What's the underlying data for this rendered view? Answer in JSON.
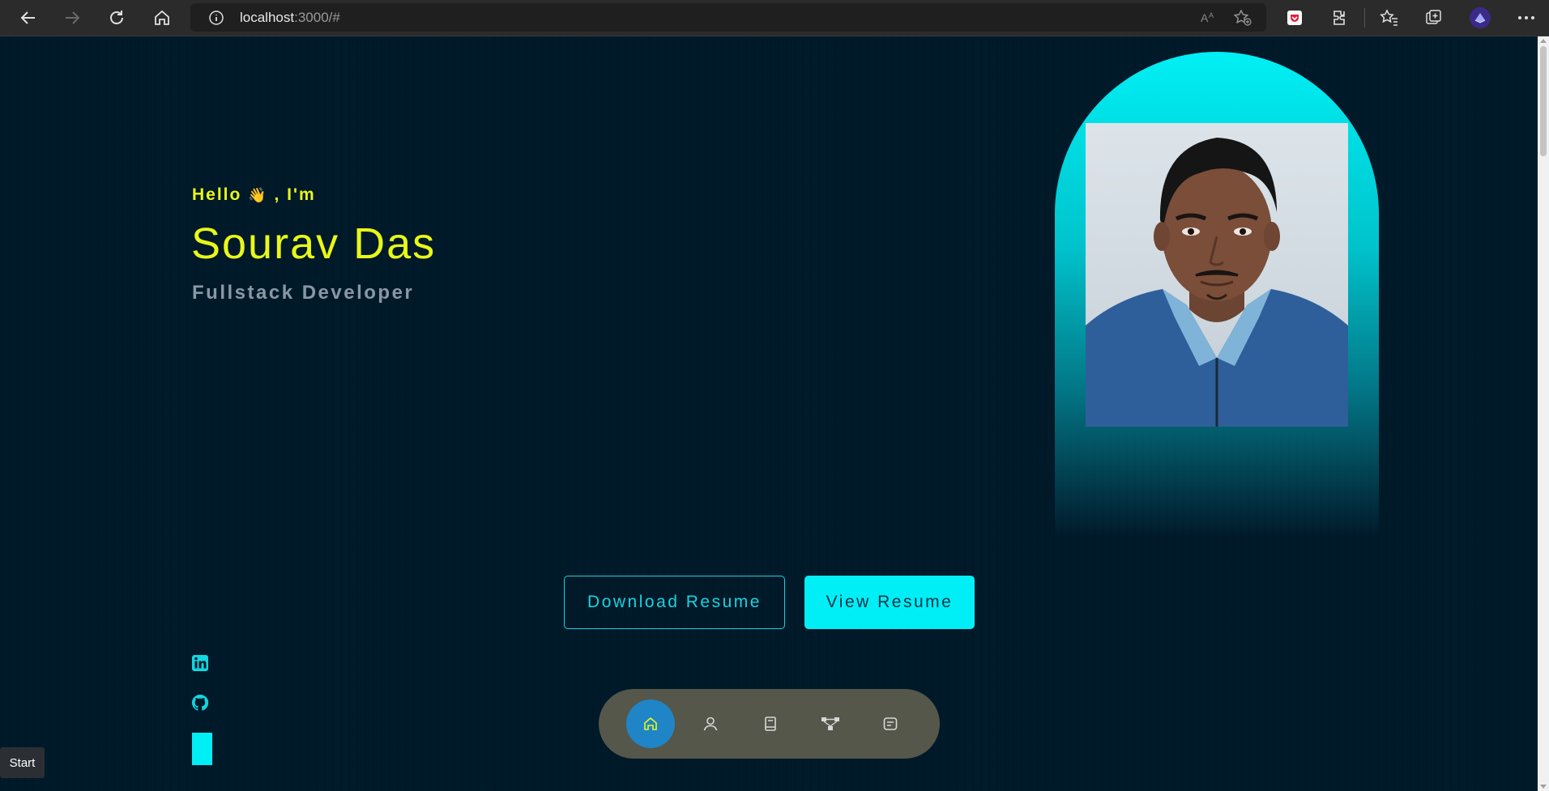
{
  "browser": {
    "url_host": "localhost",
    "url_rest": ":3000/#"
  },
  "hero": {
    "greeting_pre": "Hello",
    "greeting_emoji": "👋",
    "greeting_post": ", I'm",
    "name": "Sourav Das",
    "role": "Fullstack Developer"
  },
  "buttons": {
    "download": "Download Resume",
    "view": "View Resume"
  },
  "nav": {
    "items": [
      "home-icon",
      "user-icon",
      "book-icon",
      "sitemap-icon",
      "message-icon"
    ],
    "active": "home"
  },
  "tooltip": {
    "label": "Start"
  },
  "colors": {
    "accent_yellow": "#e8f818",
    "accent_cyan": "#00eff7",
    "background": "#011a2a",
    "nav_bg": "#54574a",
    "nav_active": "#1f85c6"
  }
}
